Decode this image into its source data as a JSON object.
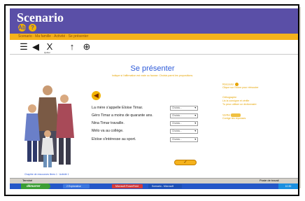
{
  "app": {
    "title": "Scenario",
    "header_buttons": [
      "Ab",
      "?"
    ],
    "menu_text": "Scenario · Ma famille · Activité · Se présenter",
    "toolbar": [
      {
        "icon": "list-icon",
        "glyph": "☰"
      },
      {
        "icon": "back-icon",
        "glyph": "◀"
      },
      {
        "icon": "close-icon",
        "glyph": "X"
      },
      {
        "icon": "pin-icon",
        "glyph": "↑"
      },
      {
        "icon": "globe-icon",
        "glyph": "⊕"
      }
    ],
    "toolbar_sub": "Quitter"
  },
  "exercise": {
    "title": "Se présenter",
    "subtitle": "Indique si l'affirmation est vraie ou fausse. Choisis parmi les propositions.",
    "family_caption": "Chapitre de ressources libres 1 · Activité 1",
    "questions": [
      {
        "label": "La mère s'appelle Eloise Timar.",
        "select_value": "Choisis..."
      },
      {
        "label": "Géro Timar a moins de quarante ans.",
        "select_value": "Choisis..."
      },
      {
        "label": "Nina Timar travaille.",
        "select_value": "Choisis..."
      },
      {
        "label": "Mélo va au collège.",
        "select_value": "Choisis..."
      },
      {
        "label": "Eloïse s'intéresse au sport.",
        "select_value": "Choisis..."
      }
    ],
    "validate_label": "✓"
  },
  "sidebar": {
    "blocks": [
      {
        "line1": "Réécouter",
        "line2": "Clique sur l'icône pour réécouter"
      },
      {
        "line1": "Orthographe",
        "line2": "Lis la consigne et vérifie",
        "line3": "Tu peux utiliser un dictionnaire"
      },
      {
        "line1": "Vérifier",
        "line2": "Corrige tes réponses"
      }
    ]
  },
  "browser_status": {
    "left": "Terminé",
    "right": "Poste de travail"
  },
  "taskbar": {
    "start_label": "démarrer",
    "items": [
      "2 Explorateur",
      "Microsoft PowerPoint",
      "Scenario - Microsoft"
    ],
    "clock": "10:30"
  },
  "colors": {
    "header": "#5a4fa7",
    "accent": "#f5b21c",
    "title_blue": "#2e5bd9",
    "taskbar": "#2457c8",
    "start": "#3c9e35"
  }
}
